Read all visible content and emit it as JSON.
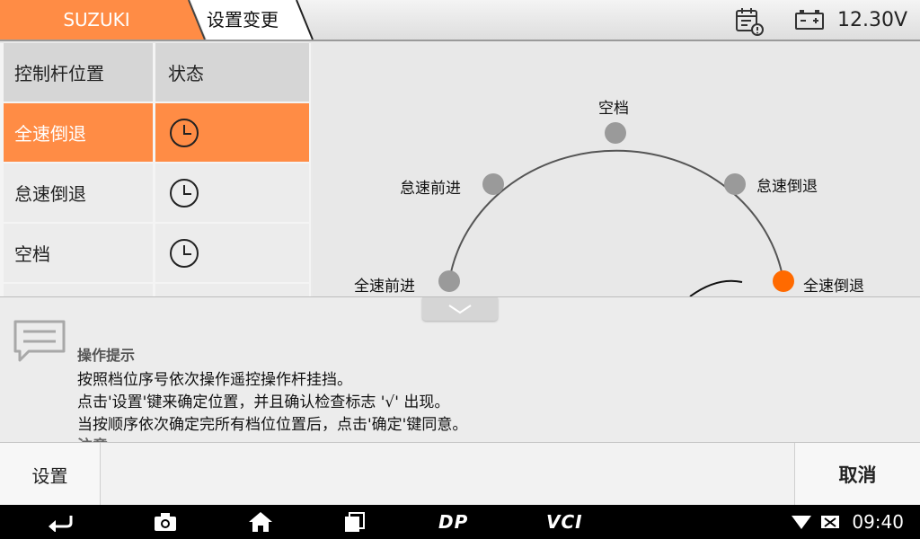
{
  "header": {
    "brand": "SUZUKI",
    "breadcrumb": "设置变更",
    "voltage": "12.30V",
    "brand_color": "#ff8c45"
  },
  "table": {
    "columns": [
      "控制杆位置",
      "状态"
    ],
    "rows": [
      {
        "position": "全速倒退",
        "status_icon": "clock-icon",
        "selected": true
      },
      {
        "position": "怠速倒退",
        "status_icon": "clock-icon",
        "selected": false
      },
      {
        "position": "空档",
        "status_icon": "clock-icon",
        "selected": false
      }
    ]
  },
  "diagram": {
    "labels": {
      "neutral": "空档",
      "idle_forward": "怠速前进",
      "idle_reverse": "怠速倒退",
      "full_forward": "全速前进",
      "full_reverse": "全速倒退"
    },
    "active": "full_reverse",
    "active_color": "#ff6a00",
    "inactive_color": "#9a9a9a"
  },
  "hint": {
    "title": "操作提示",
    "lines": [
      "按照档位序号依次操作遥控操作杆挂挡。",
      "点击'设置'键来确定位置，并且确认检查标志 '√' 出现。",
      "当按顺序依次确定完所有档位位置后，点击'确定'键同意。",
      "注意"
    ]
  },
  "buttons": {
    "set": "设置",
    "cancel": "取消"
  },
  "navbar": {
    "dp_label": "DP",
    "vci_label": "VCI",
    "time": "09:40"
  }
}
